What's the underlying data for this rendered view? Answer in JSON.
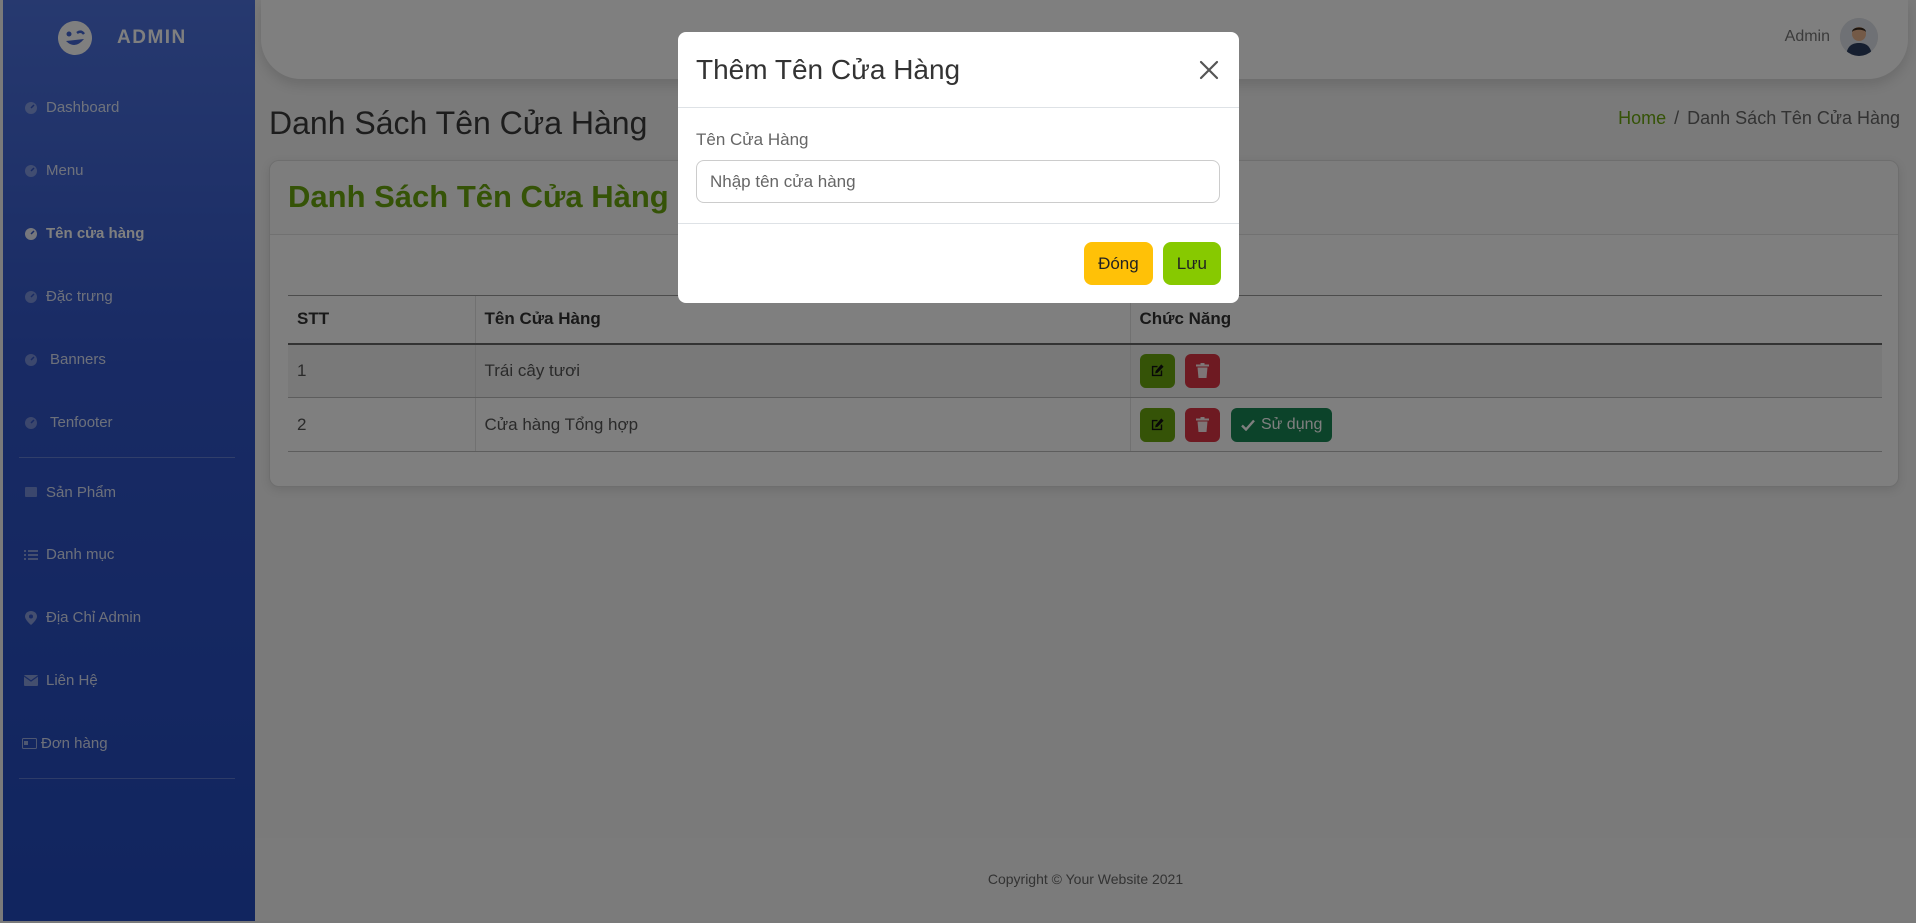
{
  "sidebar": {
    "brand": "ADMIN",
    "items": [
      {
        "label": "Dashboard",
        "icon": "dashboard-icon"
      },
      {
        "label": "Menu",
        "icon": "dashboard-icon"
      },
      {
        "label": "Tên cửa hàng",
        "icon": "dashboard-icon",
        "active": true
      },
      {
        "label": "Đặc trưng",
        "icon": "dashboard-icon"
      },
      {
        "label": "Banners",
        "icon": "dashboard-icon"
      },
      {
        "label": "Tenfooter",
        "icon": "dashboard-icon"
      },
      {
        "label": "Sản Phẩm",
        "icon": "table-icon"
      },
      {
        "label": "Danh mục",
        "icon": "list-icon"
      },
      {
        "label": "Địa Chỉ Admin",
        "icon": "map-pin-icon"
      },
      {
        "label": "Liên Hệ",
        "icon": "envelope-icon"
      },
      {
        "label": "Đơn hàng",
        "icon": "id-card-icon"
      }
    ]
  },
  "topbar": {
    "user_name": "Admin"
  },
  "page": {
    "title": "Danh Sách Tên Cửa Hàng",
    "breadcrumb": {
      "home": "Home",
      "separator": "/",
      "current": "Danh Sách Tên Cửa Hàng"
    }
  },
  "card": {
    "title": "Danh Sách Tên Cửa Hàng",
    "table": {
      "headers": [
        "STT",
        "Tên Cửa Hàng",
        "Chức Năng"
      ],
      "rows": [
        {
          "stt": "1",
          "name": "Trái cây tươi"
        },
        {
          "stt": "2",
          "name": "Cửa hàng Tổng hợp",
          "use_label": "Sử dụng"
        }
      ]
    }
  },
  "footer": {
    "text": "Copyright © Your Website 2021"
  },
  "modal": {
    "title": "Thêm Tên Cửa Hàng",
    "label": "Tên Cửa Hàng",
    "input_placeholder": "Nhập tên cửa hàng",
    "input_value": "",
    "close_label": "Đóng",
    "save_label": "Lưu"
  },
  "colors": {
    "sidebar": "#4e73df",
    "accent_green": "#6aa60f",
    "danger": "#dc3545",
    "success": "#198754",
    "warning": "#ffc107",
    "save": "#87c900"
  }
}
